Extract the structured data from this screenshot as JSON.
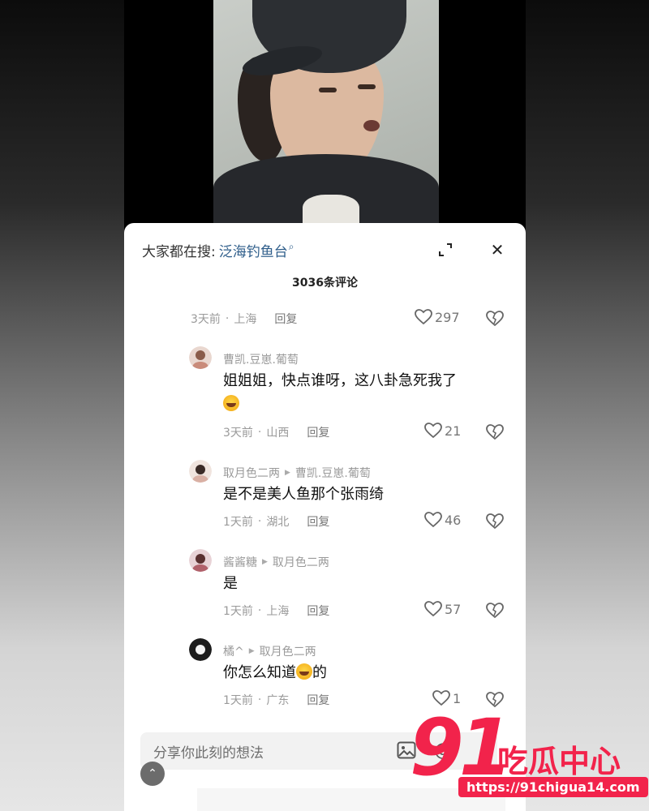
{
  "search": {
    "prefix": "大家都在搜:",
    "term": "泛海钓鱼台",
    "glyph": "⌕"
  },
  "header": {
    "comment_count": "3036条评论",
    "close_icon": "✕"
  },
  "top_meta": {
    "time": "3天前",
    "location": "上海",
    "reply": "回复",
    "likes": "297"
  },
  "comments": [
    {
      "user": "曹凯.豆崽.葡萄",
      "reply_to": "",
      "text": "姐姐姐，快点谁呀，这八卦急死我了",
      "has_emoji": true,
      "time": "3天前",
      "location": "山西",
      "reply": "回复",
      "likes": "21"
    },
    {
      "user": "取月色二两",
      "reply_to": "曹凯.豆崽.葡萄",
      "text": "是不是美人鱼那个张雨绮",
      "time": "1天前",
      "location": "湖北",
      "reply": "回复",
      "likes": "46"
    },
    {
      "user": "酱酱糖",
      "reply_to": "取月色二两",
      "text": "是",
      "time": "1天前",
      "location": "上海",
      "reply": "回复",
      "likes": "57"
    },
    {
      "user": "橘^",
      "reply_to": "取月色二两",
      "text_before": "你怎么知道",
      "text_after": "的",
      "time": "1天前",
      "location": "广东",
      "reply": "回复",
      "likes": "1"
    }
  ],
  "input": {
    "placeholder": "分享你此刻的想法",
    "at_icon": "@",
    "up_icon": "⌃"
  },
  "watermark": {
    "number": "91",
    "name": "吃瓜中心",
    "url": "https://91chigua14.com"
  },
  "colors": {
    "accent_link": "#2e5d8a",
    "watermark": "#f2234b"
  }
}
